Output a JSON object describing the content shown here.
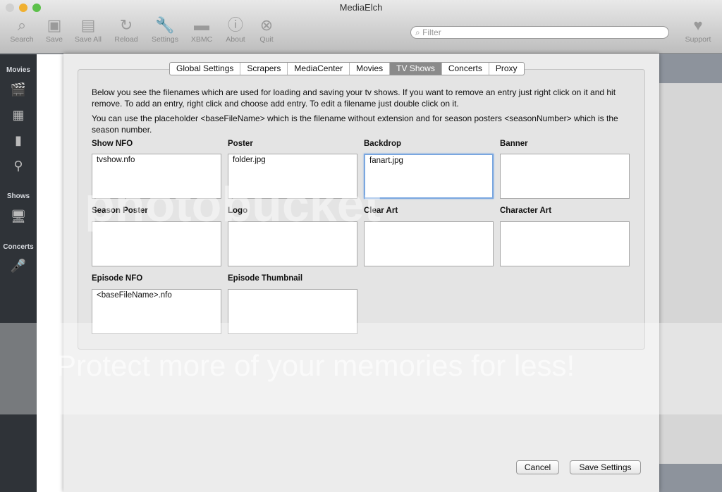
{
  "window": {
    "title": "MediaElch"
  },
  "toolbar": {
    "items": [
      {
        "label": "Search",
        "icon": "search-icon",
        "glyph": "⌕"
      },
      {
        "label": "Save",
        "icon": "save-icon",
        "glyph": "▣"
      },
      {
        "label": "Save All",
        "icon": "save-all-icon",
        "glyph": "▤"
      },
      {
        "label": "Reload",
        "icon": "reload-icon",
        "glyph": "↻"
      },
      {
        "label": "Settings",
        "icon": "wrench-icon",
        "glyph": "🔧"
      },
      {
        "label": "XBMC",
        "icon": "xbmc-icon",
        "glyph": "▬"
      },
      {
        "label": "About",
        "icon": "info-icon",
        "glyph": "ⓘ"
      },
      {
        "label": "Quit",
        "icon": "quit-icon",
        "glyph": "⊗"
      }
    ],
    "filter_placeholder": "Filter",
    "support_label": "Support"
  },
  "sidebar": {
    "movies": "Movies",
    "shows": "Shows",
    "concerts": "Concerts"
  },
  "settings": {
    "tabs": [
      "Global Settings",
      "Scrapers",
      "MediaCenter",
      "Movies",
      "TV Shows",
      "Concerts",
      "Proxy"
    ],
    "active_tab": "TV Shows",
    "intro1": "Below you see the filenames which are used for loading and saving your tv shows. If you want to remove an entry just right click on it and hit remove. To add an entry, right click and choose add entry. To edit a filename just double click on it.",
    "intro2": "You can use the placeholder <baseFileName> which is the filename without extension and for season posters <seasonNumber> which is the season number.",
    "fields": [
      {
        "label": "Show NFO",
        "value": "tvshow.nfo"
      },
      {
        "label": "Poster",
        "value": "folder.jpg"
      },
      {
        "label": "Backdrop",
        "value": "fanart.jpg"
      },
      {
        "label": "Banner",
        "value": ""
      },
      {
        "label": "Season Poster",
        "value": ""
      },
      {
        "label": "Logo",
        "value": ""
      },
      {
        "label": "Clear Art",
        "value": ""
      },
      {
        "label": "Character Art",
        "value": ""
      },
      {
        "label": "Episode NFO",
        "value": "<baseFileName>.nfo"
      },
      {
        "label": "Episode Thumbnail",
        "value": ""
      }
    ],
    "cancel": "Cancel",
    "save": "Save Settings"
  },
  "watermark": {
    "logo": "photobucket",
    "tagline": "Protect more of your memories for less!"
  }
}
